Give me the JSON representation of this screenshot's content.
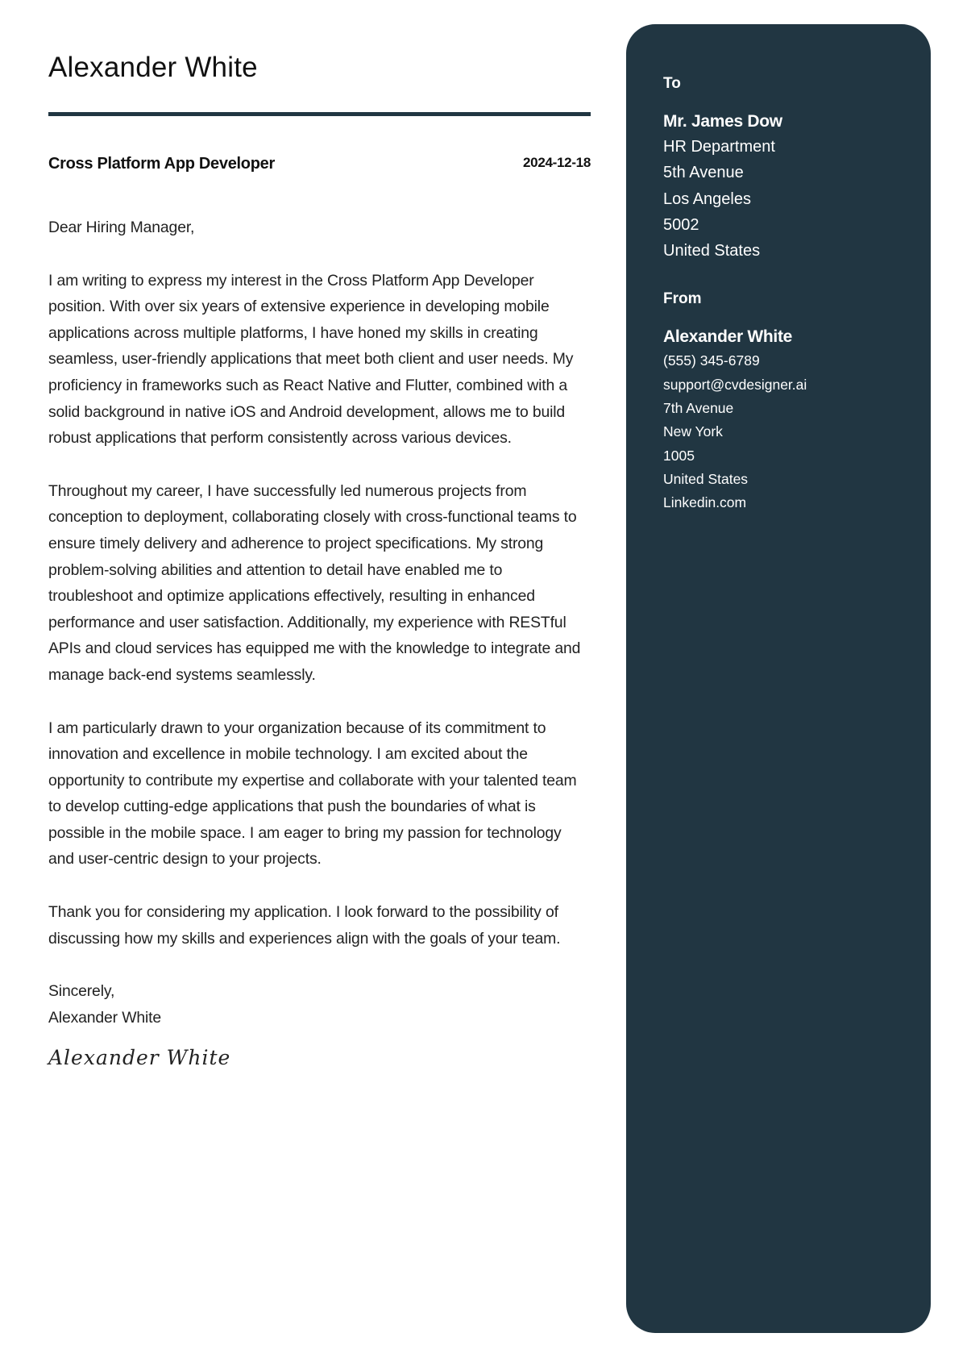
{
  "header": {
    "name": "Alexander White",
    "job_title": "Cross Platform App Developer",
    "date": "2024-12-18"
  },
  "letter": {
    "salutation": "Dear Hiring Manager,",
    "paragraphs": [
      "I am writing to express my interest in the Cross Platform App Developer position. With over six years of extensive experience in developing mobile applications across multiple platforms, I have honed my skills in creating seamless, user-friendly applications that meet both client and user needs. My proficiency in frameworks such as React Native and Flutter, combined with a solid background in native iOS and Android development, allows me to build robust applications that perform consistently across various devices.",
      "Throughout my career, I have successfully led numerous projects from conception to deployment, collaborating closely with cross-functional teams to ensure timely delivery and adherence to project specifications. My strong problem-solving abilities and attention to detail have enabled me to troubleshoot and optimize applications effectively, resulting in enhanced performance and user satisfaction. Additionally, my experience with RESTful APIs and cloud services has equipped me with the knowledge to integrate and manage back-end systems seamlessly.",
      "I am particularly drawn to your organization because of its commitment to innovation and excellence in mobile technology. I am excited about the opportunity to contribute my expertise and collaborate with your talented team to develop cutting-edge applications that push the boundaries of what is possible in the mobile space. I am eager to bring my passion for technology and user-centric design to your projects.",
      "Thank you for considering my application. I look forward to the possibility of discussing how my skills and experiences align with the goals of your team."
    ],
    "closing": "Sincerely,",
    "closing_name": "Alexander White",
    "signature": "Alexander White"
  },
  "sidebar": {
    "background_color": "#213642",
    "to": {
      "heading": "To",
      "name": "Mr. James Dow",
      "lines": [
        "HR Department",
        "5th Avenue",
        "Los Angeles",
        "5002",
        "United States"
      ]
    },
    "from": {
      "heading": "From",
      "name": "Alexander White",
      "phone": "(555) 345-6789",
      "email": "support@cvdesigner.ai",
      "street": "7th Avenue",
      "city": "New York",
      "postal_code": "1005",
      "country": "United States",
      "website": "Linkedin.com"
    }
  }
}
